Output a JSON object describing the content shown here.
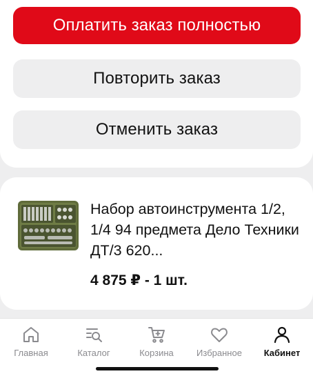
{
  "actions": {
    "pay_full": "Оплатить заказ полностью",
    "repeat": "Повторить заказ",
    "cancel": "Отменить заказ"
  },
  "product": {
    "name": "Набор автоинструмента 1/2, 1/4 94 предмета Дело Техники ДТ/3 620...",
    "price_qty": "4 875 ₽ - 1 шт.",
    "image_icon": "tool-case-image"
  },
  "nav": {
    "items": [
      {
        "label": "Главная",
        "icon": "home-icon",
        "active": false
      },
      {
        "label": "Каталог",
        "icon": "catalog-search-icon",
        "active": false
      },
      {
        "label": "Корзина",
        "icon": "cart-icon",
        "active": false
      },
      {
        "label": "Избранное",
        "icon": "heart-icon",
        "active": false
      },
      {
        "label": "Кабинет",
        "icon": "profile-icon",
        "active": true
      }
    ]
  },
  "colors": {
    "accent": "#e00a18",
    "secondary_button": "#eeeeef",
    "inactive_nav": "#8a8a8e"
  }
}
